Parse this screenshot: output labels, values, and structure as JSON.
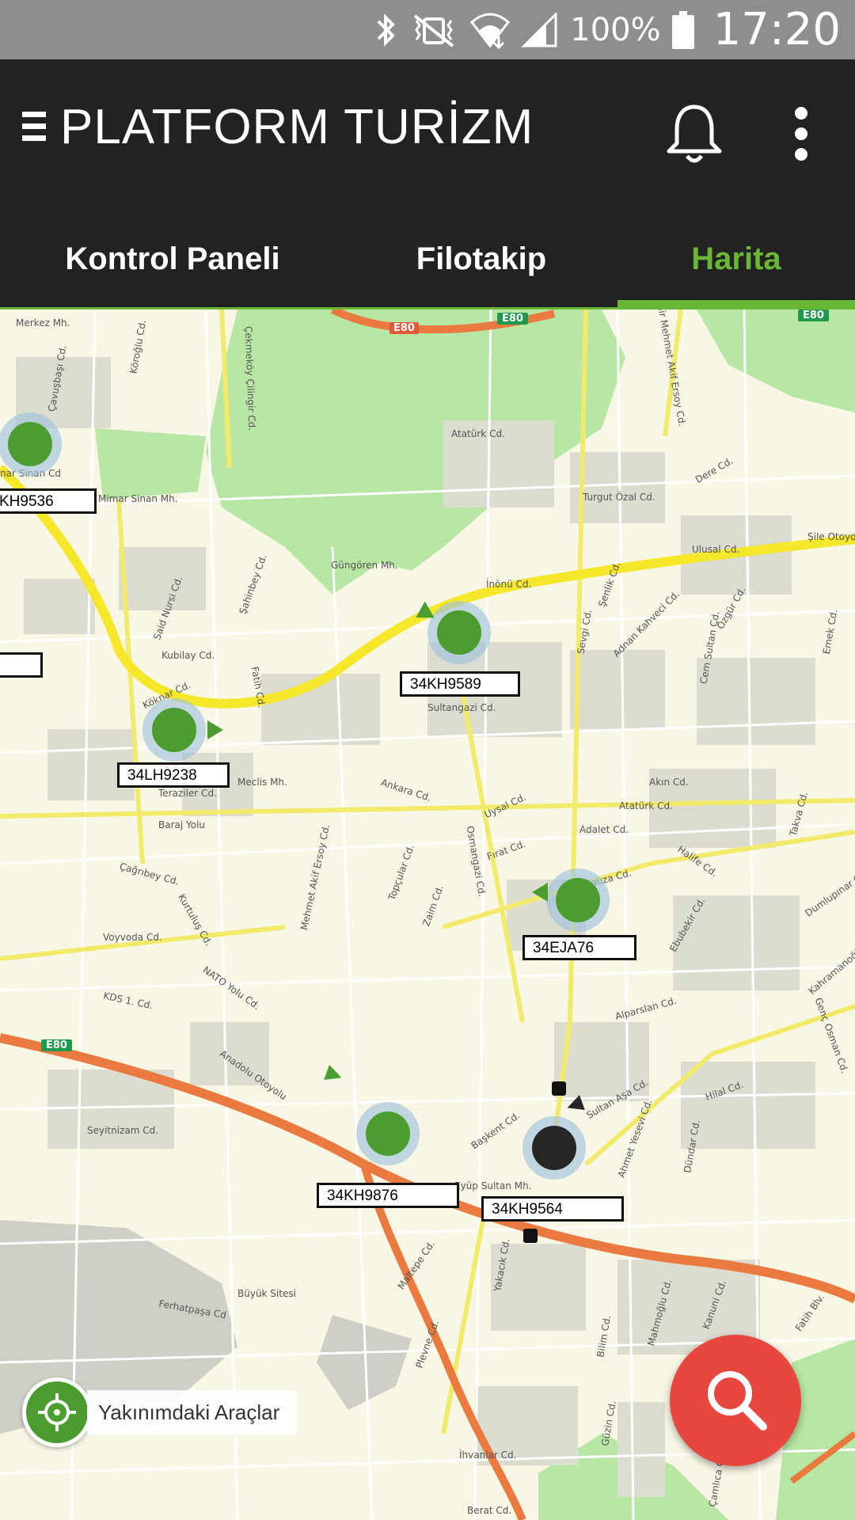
{
  "status_bar": {
    "battery_percent": "100%",
    "clock": "17:20",
    "icons": [
      "bluetooth-icon",
      "vibrate-icon",
      "wifi-icon",
      "signal-icon",
      "battery-icon"
    ]
  },
  "app_bar": {
    "title": "PLATFORM TURİZM",
    "icons": [
      "menu-icon",
      "bell-icon",
      "overflow-menu-icon"
    ]
  },
  "tabs": [
    {
      "label": "Kontrol Paneli",
      "active": false
    },
    {
      "label": "Filotakip",
      "active": false
    },
    {
      "label": "Harita",
      "active": true
    }
  ],
  "colors": {
    "accent": "#6ab636",
    "app_bar": "#222222",
    "status_bar": "#8e8e8e",
    "vehicle_moving": "#4b9d30",
    "vehicle_stopped": "#262626",
    "fab": "#e8473d"
  },
  "map": {
    "vehicles": [
      {
        "plate": "KH9536",
        "status": "moving"
      },
      {
        "plate": "34KH9589",
        "status": "moving"
      },
      {
        "plate": "34LH9238",
        "status": "moving"
      },
      {
        "plate": "34EJA76",
        "status": "moving"
      },
      {
        "plate": "34KH9876",
        "status": "moving"
      },
      {
        "plate": "34KH9564",
        "status": "stopped"
      }
    ],
    "road_labels": [
      "E80",
      "E80",
      "E80",
      "E80"
    ],
    "street_labels": [
      "Merkez Mh.",
      "Köroğlu Cd.",
      "Çavuşbaşı Cd.",
      "Mimar Sinan Mh.",
      "nar Sinan Cd",
      "Çekmeköy Çilingir Cd.",
      "Atatürk Cd.",
      "Turgut Özal Cd.",
      "Ulusal Cd.",
      "Şile Otoyolu",
      "Güngören Mh.",
      "İnönü Cd.",
      "Said Nursi Cd.",
      "Şahinbey Cd.",
      "Kubilay Cd.",
      "Köknar Cd.",
      "Fatih Cd.",
      "Sultangazi Cd.",
      "Meclis Mh.",
      "Teraziler Cd.",
      "Baraj Yolu",
      "Ankara Cd.",
      "Uysal Cd.",
      "Adalet Cd.",
      "Atatürk Cd.",
      "Osmangazi Cd.",
      "Fırat Cd.",
      "Rauza Cd.",
      "Ebubekir Cd.",
      "Çağrıbey Cd.",
      "Kurtuluş Cd.",
      "Mehmet Akif Ersoy Cd.",
      "Topçular Cd.",
      "Zaim Cd.",
      "Voyvoda Cd.",
      "NATO Yolu Cd.",
      "KDS 1. Cd.",
      "Alparslan Cd.",
      "Anadolu Otoyolu",
      "Seyitnizam Cd.",
      "Başkent Cd.",
      "Eyüp Sultan Mh.",
      "Ahmet Yesevi Cd.",
      "Dündar Cd.",
      "Hilal Cd.",
      "Ferhatpaşa Cd",
      "Büyük Sitesi",
      "Maltepe Cd.",
      "Yakacık Cd.",
      "Plevne Cd.",
      "Bilim Cd.",
      "Mahmoğlu Cd.",
      "Kanuni Cd.",
      "Fatih Blv.",
      "İhvanlar Cd.",
      "Berat Cd.",
      "Güzin Cd.",
      "Çamlıca Cd.",
      "Sultan Aşa Cd.",
      "Akın Cd.",
      "Halife Cd.",
      "Takva Cd.",
      "Dumlupınar Cd.",
      "Kahramanoğlu Cd.",
      "Genç Osman Cd.",
      "Cem Sultan Cd.",
      "Adnan Kahveci Cd.",
      "Sevgi Cd.",
      "Şenlik Cd.",
      "Özgür Cd.",
      "Emek Cd.",
      "Dere Cd.",
      "Şair Mehmet Akif Ersoy Cd."
    ]
  },
  "nearby_button": {
    "label": "Yakınımdaki Araçlar"
  },
  "search_fab": {
    "icon": "search-icon"
  }
}
